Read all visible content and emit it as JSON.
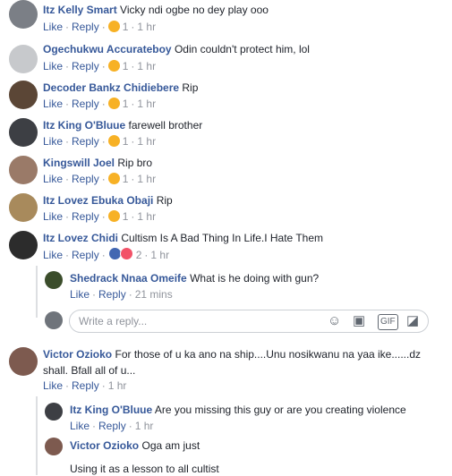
{
  "actions": {
    "like": "Like",
    "reply": "Reply",
    "sep": "·"
  },
  "comments": [
    {
      "name": "Itz Kelly Smart",
      "text": "Vicky ndi ogbe no dey play ooo",
      "reaction": "haha-emoji",
      "count": "1",
      "time": "1 hr"
    },
    {
      "name": "Ogechukwu Accurateboy",
      "text": "Odin couldn't protect him, lol",
      "reaction": "haha-emoji",
      "count": "1",
      "time": "1 hr"
    },
    {
      "name": "Decoder Bankz Chidiebere",
      "text": "Rip",
      "reaction": "sad-emoji",
      "count": "1",
      "time": "1 hr"
    },
    {
      "name": "Itz King O'Bluue",
      "text": "farewell brother",
      "reaction": "sad-emoji",
      "count": "1",
      "time": "1 hr"
    },
    {
      "name": "Kingswill Joel",
      "text": "Rip bro",
      "reaction": "sad-emoji",
      "count": "1",
      "time": "1 hr"
    },
    {
      "name": "Itz Lovez Ebuka Obaji",
      "text": "Rip",
      "reaction": "sad-emoji",
      "count": "1",
      "time": "1 hr"
    },
    {
      "name": "Itz Lovez Chidi",
      "text": "Cultism Is A Bad Thing In Life.I Hate Them",
      "reaction": "like-love-emoji",
      "count": "2",
      "time": "1 hr"
    },
    {
      "name": "Victor Ozioko",
      "text1": "For those of u ka ano na ship....Unu nosikwanu na yaa ike......dz",
      "text2": "shall. Bfall all of u...",
      "time": "1 hr"
    }
  ],
  "replies": [
    {
      "name": "Shedrack Nnaa Omeife",
      "text": "What is he doing with gun?",
      "time": "21 mins"
    },
    {
      "name": "Itz King O'Bluue",
      "text": "Are you missing this guy or are you creating violence",
      "time": "1 hr"
    },
    {
      "name": "Victor Ozioko",
      "text": "Oga am just",
      "text2": "Using it as a lesson to all cultist"
    }
  ],
  "reply_box": {
    "placeholder": "Write a reply..."
  },
  "tool_icons": [
    "emoji-icon",
    "camera-icon",
    "gif-icon",
    "sticker-icon"
  ],
  "colors": {
    "name_blue": "#365899",
    "meta_gray": "#90949c",
    "border": "#dddfe2"
  }
}
